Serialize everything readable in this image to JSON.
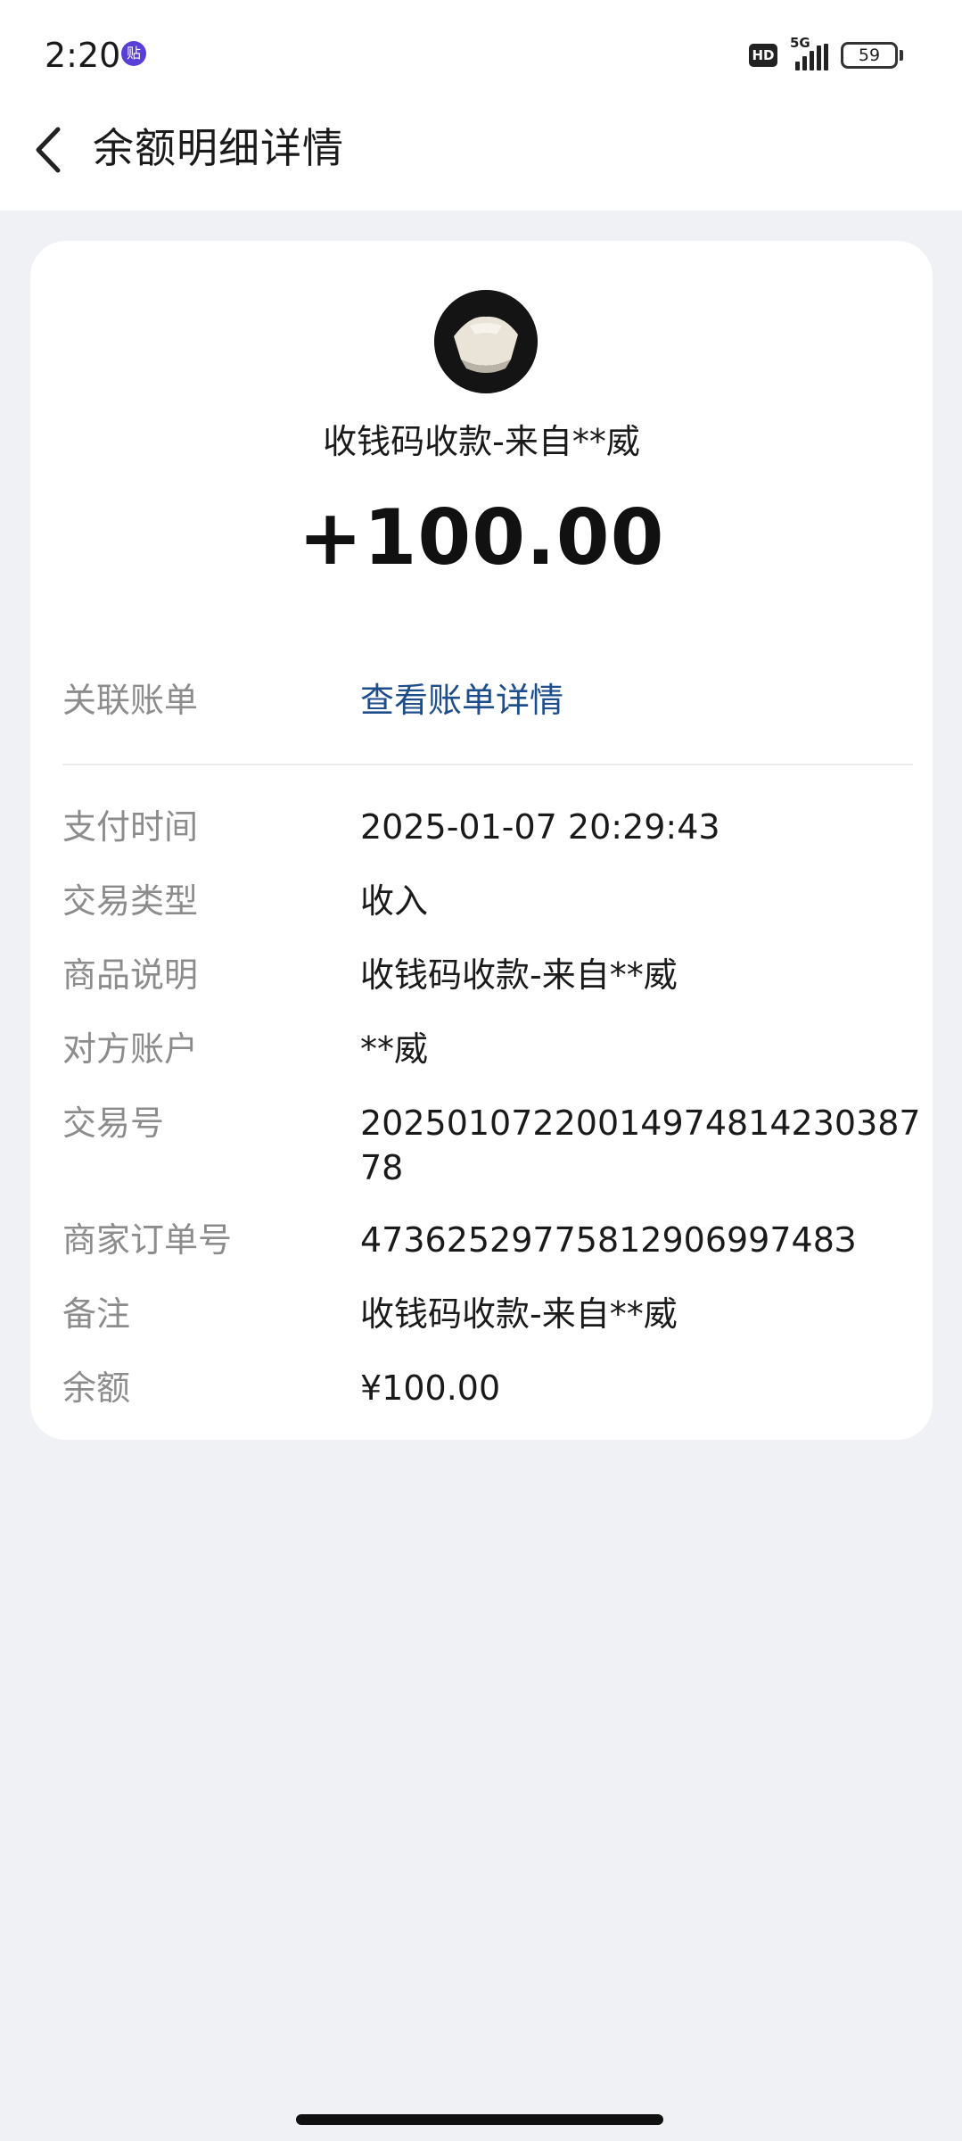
{
  "status_bar": {
    "time": "2:20",
    "notification_badge": "贴",
    "hd": "HD",
    "network": "5G",
    "signal_bars": 4,
    "battery": "59"
  },
  "header": {
    "title": "余额明细详情"
  },
  "transaction": {
    "summary": "收钱码收款-来自**威",
    "amount": "+100.00",
    "related_bill_label": "关联账单",
    "related_bill_link": "查看账单详情",
    "details": [
      {
        "label": "支付时间",
        "value": "2025-01-07 20:29:43"
      },
      {
        "label": "交易类型",
        "value": "收入"
      },
      {
        "label": "商品说明",
        "value": "收钱码收款-来自**威"
      },
      {
        "label": "对方账户",
        "value": "**威"
      },
      {
        "label": "交易号",
        "value": "2025010722001497481423038778"
      },
      {
        "label": "商家订单号",
        "value": "4736252977581290699748З"
      },
      {
        "label": "备注",
        "value": "收钱码收款-来自**威"
      },
      {
        "label": "余额",
        "value": "¥100.00"
      }
    ]
  },
  "colors": {
    "background": "#f0f1f5",
    "card": "#ffffff",
    "link": "#1e4d8c",
    "label": "#8c8c8c"
  }
}
